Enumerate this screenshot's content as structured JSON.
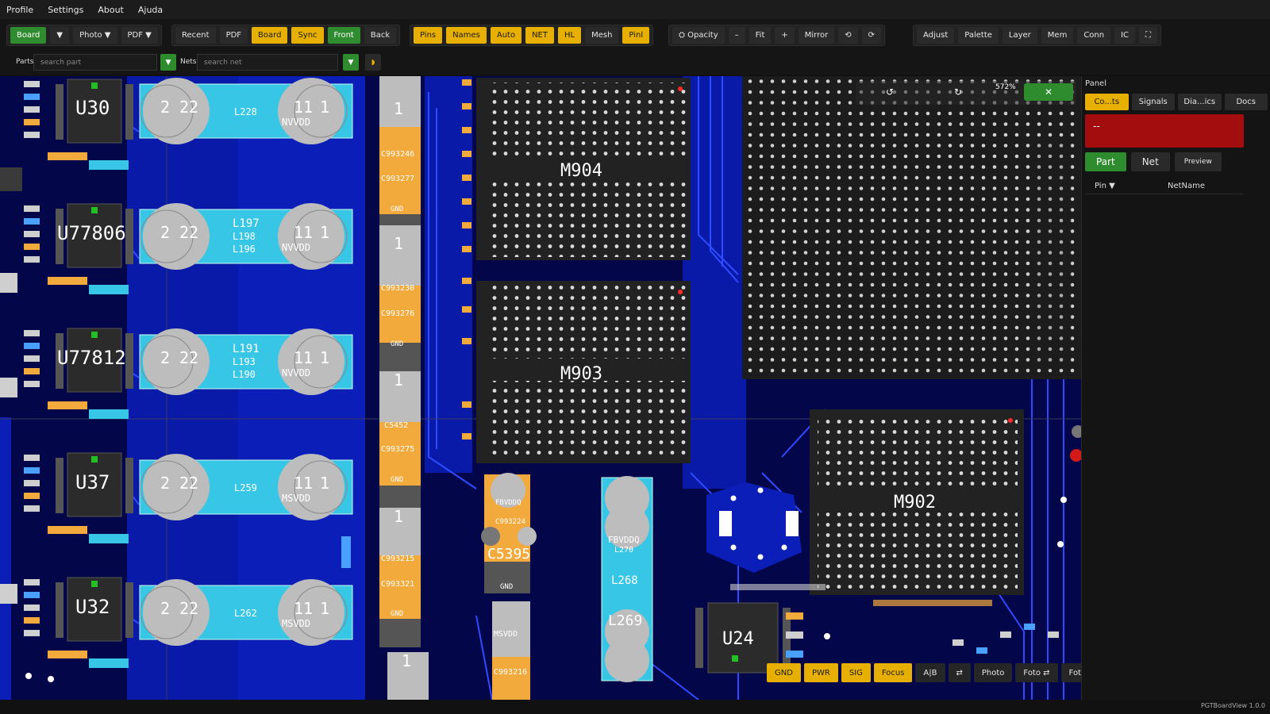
{
  "menu": [
    "Profile",
    "Settings",
    "About",
    "Ajuda"
  ],
  "toolbar": {
    "group1": [
      {
        "label": "Board",
        "style": "green"
      },
      {
        "label": "▼",
        "style": "dark"
      },
      {
        "label": "Photo ▼",
        "style": "dark"
      },
      {
        "label": "PDF ▼",
        "style": "dark"
      }
    ],
    "group2": [
      {
        "label": "Recent",
        "style": "dark"
      },
      {
        "label": "PDF",
        "style": "dark"
      },
      {
        "label": "Board",
        "style": "yellow"
      },
      {
        "label": "Sync",
        "style": "yellow"
      },
      {
        "label": "Front",
        "style": "green"
      },
      {
        "label": "Back",
        "style": "dark"
      }
    ],
    "group3": [
      {
        "label": "Pins",
        "style": "yellow"
      },
      {
        "label": "Names",
        "style": "yellow"
      },
      {
        "label": "Auto",
        "style": "yellow"
      },
      {
        "label": "NET",
        "style": "yellow"
      },
      {
        "label": "HL",
        "style": "yellow"
      },
      {
        "label": "Mesh",
        "style": "dark"
      },
      {
        "label": "Pinl",
        "style": "yellow"
      }
    ],
    "group4": [
      {
        "label": "⛭ Opacity",
        "style": "dark"
      },
      {
        "label": "–",
        "style": "dark"
      },
      {
        "label": "Fit",
        "style": "dark"
      },
      {
        "label": "+",
        "style": "dark"
      },
      {
        "label": "Mirror",
        "style": "dark"
      },
      {
        "label": "⟲",
        "style": "dark"
      },
      {
        "label": "⟳",
        "style": "dark"
      }
    ],
    "group5": [
      {
        "label": "Adjust",
        "style": "dark"
      },
      {
        "label": "Palette",
        "style": "dark"
      },
      {
        "label": "Layer",
        "style": "dark"
      },
      {
        "label": "Mem",
        "style": "dark"
      },
      {
        "label": "Conn",
        "style": "dark"
      },
      {
        "label": "IC",
        "style": "dark"
      },
      {
        "label": "⛶",
        "style": "dark"
      }
    ]
  },
  "search": {
    "parts_label": "Parts",
    "parts_placeholder": "search part",
    "nets_label": "Nets",
    "nets_placeholder": "search net",
    "filter_icon": "▼",
    "extra_icon": "◗"
  },
  "board": {
    "overlay": {
      "rotate_left": "↺",
      "rotate_right": "↻",
      "zoom": "572%",
      "close": "✕"
    },
    "labels": {
      "u30": "U30",
      "u77806": "U77806",
      "u77812": "U77812",
      "u37": "U37",
      "u32": "U32",
      "m904": "M904",
      "m903": "M903",
      "m902": "M902",
      "u24": "U24",
      "l228": "L228",
      "l197": "L197",
      "l198": "L198",
      "l196": "L196",
      "l191": "L191",
      "l193": "L193",
      "l190": "L190",
      "l259": "L259",
      "l262": "L262",
      "c993246": "C993246",
      "c993277": "C993277",
      "c993230": "C993230",
      "c993276": "C993276",
      "c5452": "C5452",
      "c993275": "C993275",
      "c993215": "C993215",
      "c993321": "C993321",
      "c993224": "C993224",
      "c5395": "C5395",
      "c993216": "C993216",
      "l270": "L270",
      "l268": "L268",
      "l269": "L269",
      "nvvdd": "NVVDD",
      "msvdd": "MSVDD",
      "fbvddq": "FBVDDQ",
      "gnd": "GND",
      "pin1": "1",
      "pin2": "2",
      "pin11": "11",
      "pin22": "22"
    },
    "bottom_buttons": [
      {
        "label": "GND",
        "style": "yellow"
      },
      {
        "label": "PWR",
        "style": "yellow"
      },
      {
        "label": "SIG",
        "style": "yellow"
      },
      {
        "label": "Focus",
        "style": "yellow"
      },
      {
        "label": "A|B",
        "style": "dark"
      },
      {
        "label": "⇄",
        "style": "dark"
      },
      {
        "label": "Photo",
        "style": "dark"
      },
      {
        "label": "Foto ⇄",
        "style": "dark"
      },
      {
        "label": "Fotos...",
        "style": "dark"
      }
    ]
  },
  "panel": {
    "title": "Panel",
    "tabs": [
      {
        "label": "Co...ts",
        "active": true
      },
      {
        "label": "Signals",
        "active": false
      },
      {
        "label": "Dia...ics",
        "active": false
      },
      {
        "label": "Docs",
        "active": false
      }
    ],
    "info_value": "--",
    "modes": [
      {
        "label": "Part",
        "active": true
      },
      {
        "label": "Net",
        "active": false
      },
      {
        "label": "Preview",
        "active": false
      }
    ],
    "columns": [
      "Pin ▼",
      "NetName"
    ]
  },
  "status": {
    "version": "PGTBoardView 1.0.0"
  },
  "colors": {
    "accent_green": "#2e8b2e",
    "accent_yellow": "#e7b000",
    "board_blue": "#04064a",
    "trace_blue": "#1c2fd0",
    "inductor_cyan": "#37c6e6",
    "cap_orange": "#f2aa3c",
    "alert_red": "#a40d0d"
  }
}
